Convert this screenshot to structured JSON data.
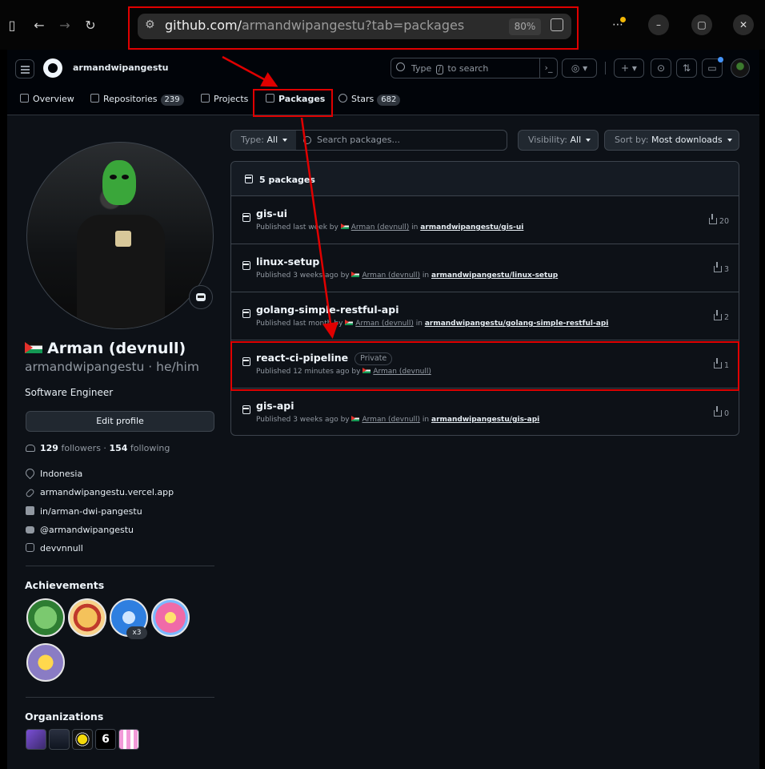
{
  "browser": {
    "url_domain": "github.com/",
    "url_path": "armandwipangestu?tab=packages",
    "zoom": "80%"
  },
  "header": {
    "username": "armandwipangestu",
    "search_prefix": "Type",
    "search_key": "/",
    "search_suffix": "to search"
  },
  "tabs": [
    {
      "label": "Overview",
      "count": null
    },
    {
      "label": "Repositories",
      "count": "239"
    },
    {
      "label": "Projects",
      "count": null
    },
    {
      "label": "Packages",
      "count": null,
      "active": true
    },
    {
      "label": "Stars",
      "count": "682"
    }
  ],
  "profile": {
    "name": "Arman (devnull)",
    "handle": "armandwipangestu · he/him",
    "bio": "Software Engineer",
    "edit_label": "Edit profile",
    "followers": "129",
    "followers_label": "followers",
    "following": "154",
    "following_label": "following",
    "details": [
      {
        "icon": "location-icon",
        "text": "Indonesia"
      },
      {
        "icon": "link-icon",
        "text": "armandwipangestu.vercel.app"
      },
      {
        "icon": "linkedin-icon",
        "text": "in/arman-dwi-pangestu"
      },
      {
        "icon": "youtube-icon",
        "text": "@armandwipangestu"
      },
      {
        "icon": "instagram-icon",
        "text": "devvnnull"
      }
    ],
    "achievements_title": "Achievements",
    "achievement_multiplier": "x3",
    "organizations_title": "Organizations"
  },
  "packages": {
    "filters": {
      "type_label": "Type:",
      "type_value": "All",
      "search_placeholder": "Search packages...",
      "visibility_label": "Visibility:",
      "visibility_value": "All",
      "sort_label": "Sort by:",
      "sort_value": "Most downloads"
    },
    "count_label": "5 packages",
    "items": [
      {
        "name": "gis-ui",
        "private": null,
        "published": "Published last week by",
        "author": "Arman (devnull)",
        "in": "in",
        "repo": "armandwipangestu/gis-ui",
        "downloads": "20"
      },
      {
        "name": "linux-setup",
        "private": null,
        "published": "Published 3 weeks ago by",
        "author": "Arman (devnull)",
        "in": "in",
        "repo": "armandwipangestu/linux-setup",
        "downloads": "3"
      },
      {
        "name": "golang-simple-restful-api",
        "private": null,
        "published": "Published last month by",
        "author": "Arman (devnull)",
        "in": "in",
        "repo": "armandwipangestu/golang-simple-restful-api",
        "downloads": "2"
      },
      {
        "name": "react-ci-pipeline",
        "private": "Private",
        "published": "Published 12 minutes ago by",
        "author": "Arman (devnull)",
        "in": "",
        "repo": "",
        "downloads": "1"
      },
      {
        "name": "gis-api",
        "private": null,
        "published": "Published 3 weeks ago by",
        "author": "Arman (devnull)",
        "in": "in",
        "repo": "armandwipangestu/gis-api",
        "downloads": "0"
      }
    ]
  },
  "colors": {
    "annotation": "#e00000",
    "accent_underline": "#f78166",
    "canvas": "#0d1117"
  }
}
